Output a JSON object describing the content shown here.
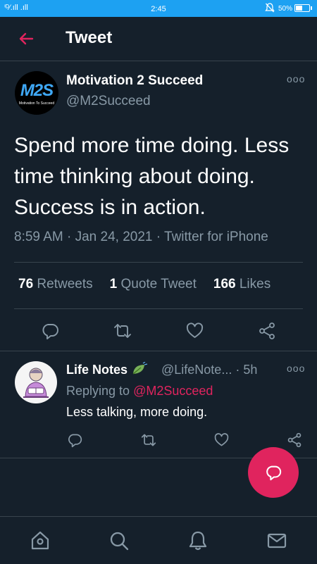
{
  "status_bar": {
    "signal_text": "ⁱᴰ⁄.ıll .ıll",
    "time": "2:45",
    "battery_text": "50%",
    "battery_level": 0.5
  },
  "header": {
    "title": "Tweet",
    "back_icon": "arrow-left-icon",
    "accent_color": "#e0245e"
  },
  "tweet": {
    "avatar_logo": "M2S",
    "avatar_tagline": "Motivation To Succeed",
    "author_name": "Motivation 2 Succeed",
    "author_handle": "@M2Succeed",
    "more_label": "ooo",
    "text": "Spend more time doing. Less time thinking about doing. Success is in action.",
    "time": "8:59 AM",
    "date": "Jan 24, 2021",
    "source": "Twitter for iPhone",
    "separator": "·",
    "stats": {
      "retweets_count": "76",
      "retweets_label": "Retweets",
      "quotes_count": "1",
      "quotes_label": "Quote Tweet",
      "likes_count": "166",
      "likes_label": "Likes"
    },
    "actions": [
      "reply-icon",
      "retweet-icon",
      "like-icon",
      "share-icon"
    ]
  },
  "reply": {
    "author_name": "Life Notes",
    "author_emoji": "leaf-icon",
    "author_handle": "@LifeNote...",
    "age": "5h",
    "separator": "·",
    "more_label": "ooo",
    "replying_prefix": "Replying to",
    "replying_mention": "@M2Succeed",
    "text": "Less talking, more doing."
  },
  "fab": {
    "icon": "compose-reply-icon",
    "color": "#e0245e"
  },
  "bottom_nav": [
    "home-icon",
    "search-icon",
    "notifications-icon",
    "messages-icon"
  ],
  "colors": {
    "background": "#15202b",
    "status_bar": "#1da1f2",
    "secondary_text": "#8899a6",
    "divider": "#38444d",
    "mention": "#e0245e"
  }
}
